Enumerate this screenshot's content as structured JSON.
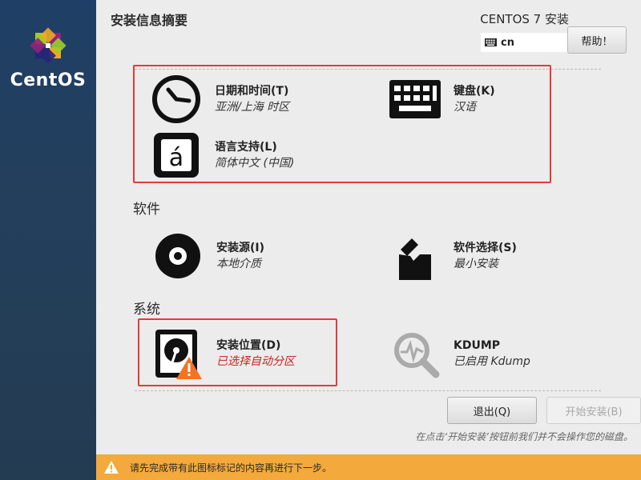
{
  "sidebar": {
    "brand_name": "CentOS",
    "logo_icon": "centos-logo"
  },
  "header": {
    "page_title": "安装信息摘要",
    "product_title": "CENTOS 7 安装",
    "keyboard_layout": "cn",
    "help_label": "帮助！"
  },
  "localization": {
    "datetime": {
      "title": "日期和时间(T)",
      "status": "亚洲/上海 时区",
      "icon": "clock-icon"
    },
    "keyboard": {
      "title": "键盘(K)",
      "status": "汉语",
      "icon": "keyboard-icon"
    },
    "language": {
      "title": "语言支持(L)",
      "status": "简体中文 (中国)",
      "icon": "language-icon"
    }
  },
  "software": {
    "section_label": "软件",
    "source": {
      "title": "安装源(I)",
      "status": "本地介质",
      "icon": "disc-icon"
    },
    "selection": {
      "title": "软件选择(S)",
      "status": "最小安装",
      "icon": "package-icon"
    }
  },
  "system": {
    "section_label": "系统",
    "destination": {
      "title": "安装位置(D)",
      "status": "已选择自动分区",
      "icon": "harddisk-warning-icon"
    },
    "kdump": {
      "title": "KDUMP",
      "status": "已启用 Kdump",
      "icon": "magnifier-icon"
    }
  },
  "footer": {
    "quit_label": "退出(Q)",
    "begin_label": "开始安装(B)",
    "hint": "在点击‘开始安装’按钮前我们并不会操作您的磁盘。"
  },
  "warning_bar": {
    "text": "请先完成带有此图标标记的内容再进行下一步。",
    "icon": "warning-triangle-icon"
  },
  "colors": {
    "sidebar": "#233f5c",
    "highlight": "#e23b3b",
    "warning_bar": "#f3a93b",
    "warning_status": "#c9211e"
  }
}
